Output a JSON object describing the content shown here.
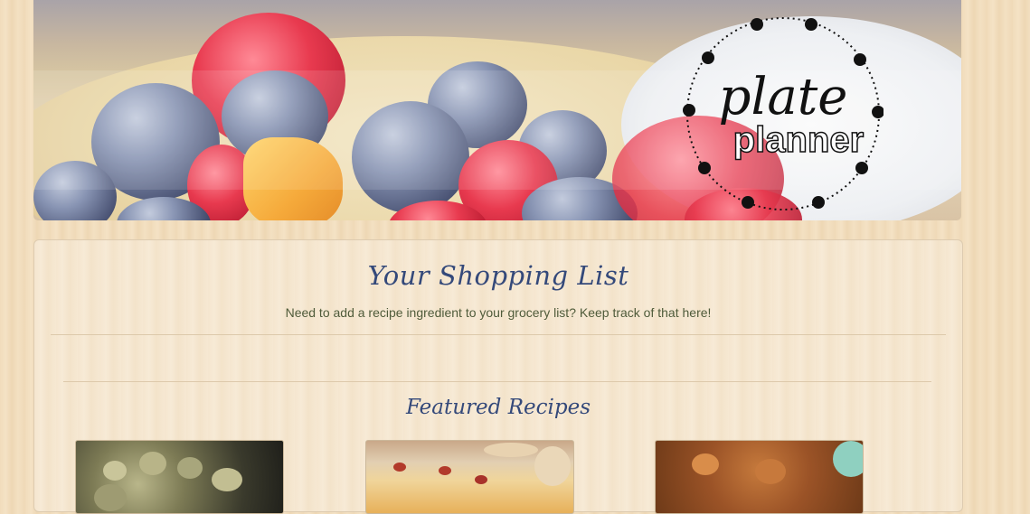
{
  "banner": {
    "logo_word_1": "plate",
    "logo_word_2": "planner"
  },
  "shopping_list": {
    "title": "Your Shopping List",
    "subtitle": "Need to add a recipe ingredient to your grocery list? Keep track of that here!"
  },
  "featured": {
    "title": "Featured Recipes",
    "recipes": [
      {
        "image": "recipe-photo-1"
      },
      {
        "image": "recipe-photo-2"
      },
      {
        "image": "recipe-photo-3"
      }
    ]
  },
  "colors": {
    "heading": "#34497a",
    "body_text": "#4f5b3a",
    "background": "#f1dcbb"
  }
}
